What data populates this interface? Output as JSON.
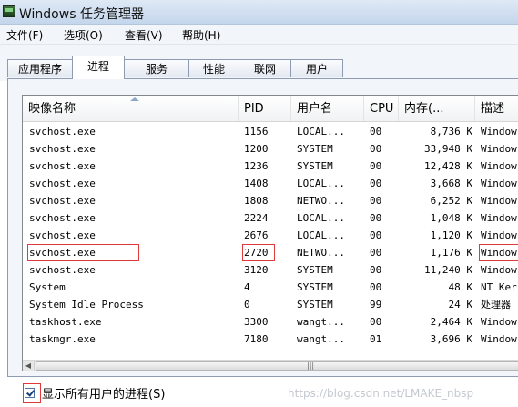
{
  "window": {
    "title": "Windows 任务管理器"
  },
  "menu": [
    "文件(F)",
    "选项(O)",
    "查看(V)",
    "帮助(H)"
  ],
  "tabs": [
    "应用程序",
    "进程",
    "服务",
    "性能",
    "联网",
    "用户"
  ],
  "active_tab": "进程",
  "columns": [
    "映像名称",
    "PID",
    "用户名",
    "CPU",
    "内存(...",
    "描述"
  ],
  "rows": [
    {
      "name": "svchost.exe",
      "pid": "1156",
      "user": "LOCAL...",
      "cpu": "00",
      "mem": "8,736 K",
      "desc": "Window"
    },
    {
      "name": "svchost.exe",
      "pid": "1200",
      "user": "SYSTEM",
      "cpu": "00",
      "mem": "33,948 K",
      "desc": "Window"
    },
    {
      "name": "svchost.exe",
      "pid": "1236",
      "user": "SYSTEM",
      "cpu": "00",
      "mem": "12,428 K",
      "desc": "Window"
    },
    {
      "name": "svchost.exe",
      "pid": "1408",
      "user": "LOCAL...",
      "cpu": "00",
      "mem": "3,668 K",
      "desc": "Window"
    },
    {
      "name": "svchost.exe",
      "pid": "1808",
      "user": "NETWO...",
      "cpu": "00",
      "mem": "6,252 K",
      "desc": "Window"
    },
    {
      "name": "svchost.exe",
      "pid": "2224",
      "user": "LOCAL...",
      "cpu": "00",
      "mem": "1,048 K",
      "desc": "Window"
    },
    {
      "name": "svchost.exe",
      "pid": "2676",
      "user": "LOCAL...",
      "cpu": "00",
      "mem": "1,120 K",
      "desc": "Window"
    },
    {
      "name": "svchost.exe",
      "pid": "2720",
      "user": "NETWO...",
      "cpu": "00",
      "mem": "1,176 K",
      "desc": "Window"
    },
    {
      "name": "svchost.exe",
      "pid": "3120",
      "user": "SYSTEM",
      "cpu": "00",
      "mem": "11,240 K",
      "desc": "Window"
    },
    {
      "name": "System",
      "pid": "4",
      "user": "SYSTEM",
      "cpu": "00",
      "mem": "48 K",
      "desc": "NT Ker"
    },
    {
      "name": "System Idle Process",
      "pid": "0",
      "user": "SYSTEM",
      "cpu": "99",
      "mem": "24 K",
      "desc": "处理器"
    },
    {
      "name": "taskhost.exe",
      "pid": "3300",
      "user": "wangt...",
      "cpu": "00",
      "mem": "2,464 K",
      "desc": "Window"
    },
    {
      "name": "taskmgr.exe",
      "pid": "7180",
      "user": "wangt...",
      "cpu": "01",
      "mem": "3,696 K",
      "desc": "Window"
    }
  ],
  "show_all_label": "显示所有用户的进程(S)",
  "show_all_checked": true,
  "watermark": "https://blog.csdn.net/LMAKE_nbsp"
}
